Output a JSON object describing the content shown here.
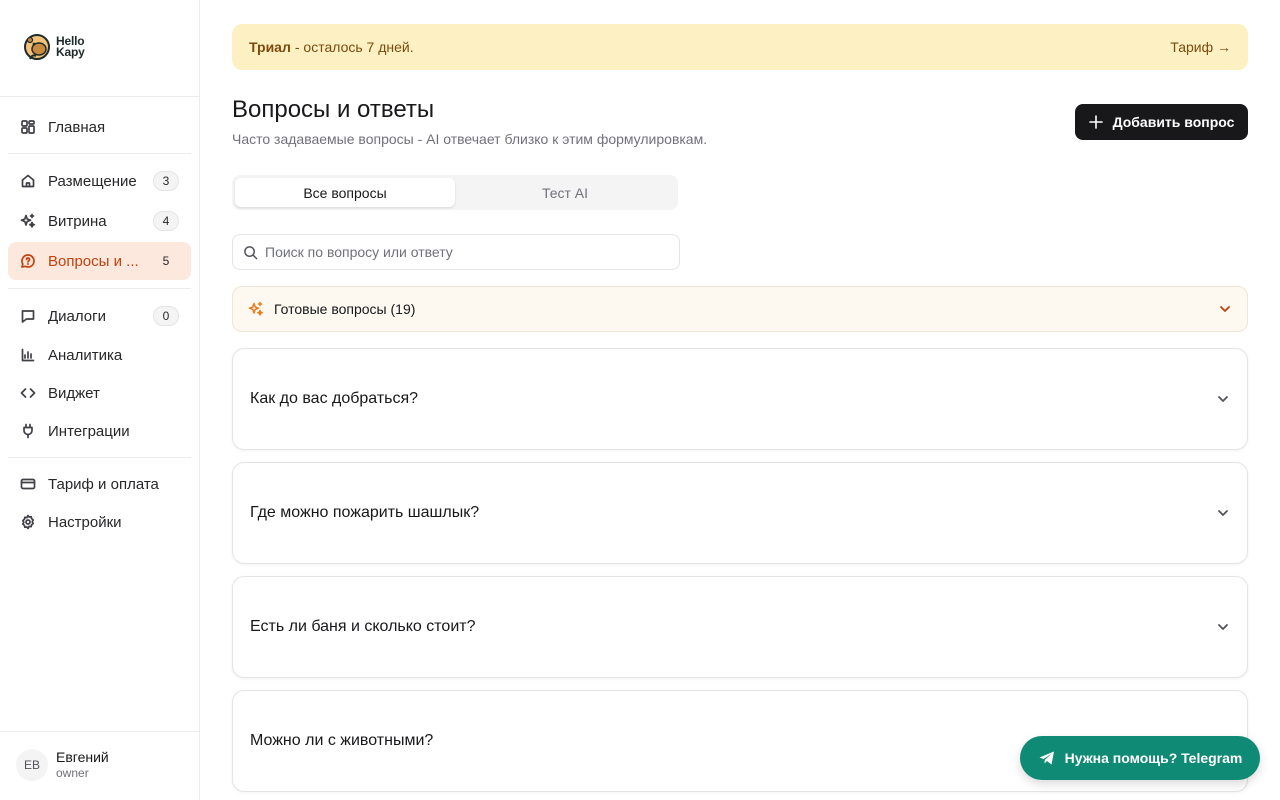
{
  "logo": {
    "line1": "Hello",
    "line2": "Kapy"
  },
  "sidebar": {
    "items": [
      {
        "label": "Главная",
        "icon": "dashboard-icon"
      },
      {
        "label": "Размещение",
        "icon": "home-icon",
        "badge": "3"
      },
      {
        "label": "Витрина",
        "icon": "sparkles-icon",
        "badge": "4"
      },
      {
        "label": "Вопросы и ...",
        "icon": "question-bubble-icon",
        "badge": "5",
        "active": true
      },
      {
        "label": "Диалоги",
        "icon": "chat-icon",
        "badge": "0"
      },
      {
        "label": "Аналитика",
        "icon": "chart-icon"
      },
      {
        "label": "Виджет",
        "icon": "code-icon"
      },
      {
        "label": "Интеграции",
        "icon": "plug-icon"
      },
      {
        "label": "Тариф и оплата",
        "icon": "credit-card-icon"
      },
      {
        "label": "Настройки",
        "icon": "gear-icon"
      }
    ]
  },
  "user": {
    "initials": "ЕВ",
    "name": "Евгений",
    "role": "owner"
  },
  "trial": {
    "bold": "Триал",
    "text": "- осталось 7 дней.",
    "link": "Тариф →"
  },
  "page": {
    "title": "Вопросы и ответы",
    "subtitle": "Часто задаваемые вопросы - AI отвечает близко к этим формулировкам.",
    "add_button": "Добавить вопрос"
  },
  "tabs": [
    {
      "label": "Все вопросы",
      "active": true
    },
    {
      "label": "Тест AI",
      "active": false
    }
  ],
  "search": {
    "placeholder": "Поиск по вопросу или ответу",
    "value": ""
  },
  "ready_questions": {
    "label": "Готовые вопросы (19)"
  },
  "faq": [
    {
      "question": "Как до вас добраться?"
    },
    {
      "question": "Где можно пожарить шашлык?"
    },
    {
      "question": "Есть ли баня и сколько стоит?"
    },
    {
      "question": "Можно ли с животными?"
    }
  ],
  "help": {
    "label": "Нужна помощь? Telegram"
  },
  "colors": {
    "accent": "#c2410c",
    "active_bg": "#fde8de",
    "trial_bg": "#fdf1c4",
    "help_bg": "#0f8a74",
    "primary_button": "#18181b"
  }
}
